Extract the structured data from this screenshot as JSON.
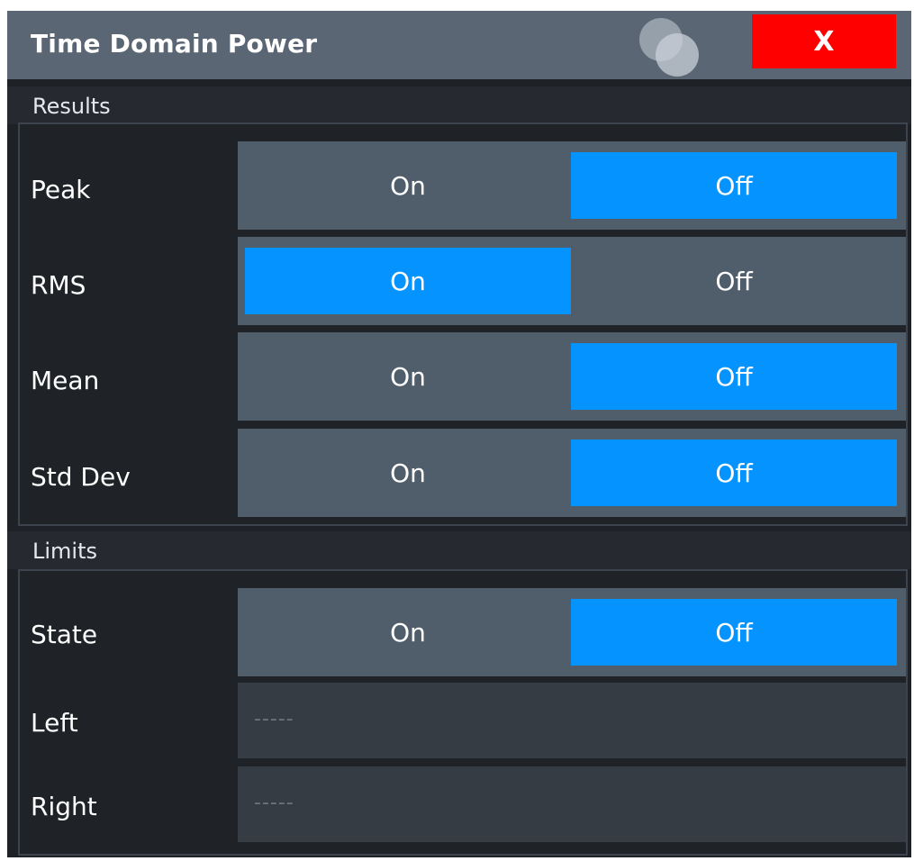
{
  "dialog": {
    "title": "Time Domain Power",
    "close_label": "X"
  },
  "results": {
    "section_label": "Results",
    "rows": [
      {
        "label": "Peak",
        "on_label": "On",
        "off_label": "Off",
        "selected": "Off"
      },
      {
        "label": "RMS",
        "on_label": "On",
        "off_label": "Off",
        "selected": "On"
      },
      {
        "label": "Mean",
        "on_label": "On",
        "off_label": "Off",
        "selected": "Off"
      },
      {
        "label": "Std Dev",
        "on_label": "On",
        "off_label": "Off",
        "selected": "Off"
      }
    ]
  },
  "limits": {
    "section_label": "Limits",
    "state": {
      "label": "State",
      "on_label": "On",
      "off_label": "Off",
      "selected": "Off"
    },
    "left": {
      "label": "Left",
      "value": "-----"
    },
    "right": {
      "label": "Right",
      "value": "-----"
    }
  },
  "colors": {
    "title_bar": "#5a6674",
    "close_button": "#ff0000",
    "active_segment": "#0594ff",
    "inactive_segment": "#505e6c",
    "background": "#1e2126"
  },
  "icons": {
    "logo": "overlapping-circles-logo-icon",
    "close": "close-icon"
  }
}
